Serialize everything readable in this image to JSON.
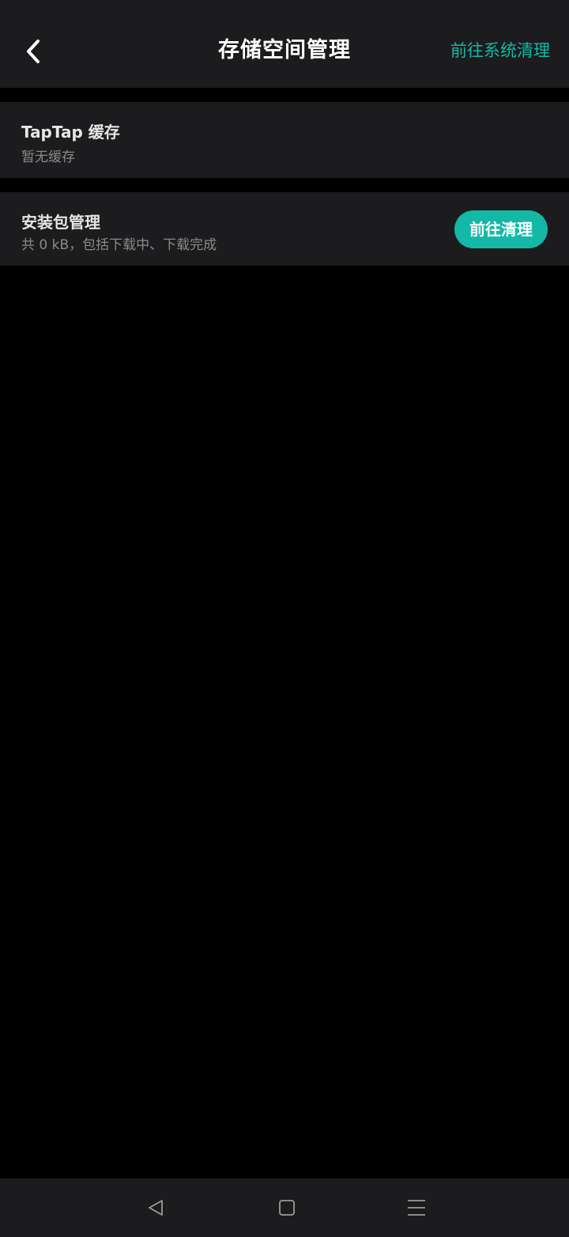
{
  "header": {
    "back_icon": "chevron-left-icon",
    "title": "存储空间管理",
    "system_clean_label": "前往系统清理"
  },
  "cache_card": {
    "title": "TapTap 缓存",
    "subtitle": "暂无缓存"
  },
  "apk_card": {
    "title": "安装包管理",
    "subtitle": "共 0 kB，包括下载中、下载完成",
    "button_label": "前往清理"
  },
  "navbar": {
    "back_icon": "triangle-back-icon",
    "home_icon": "square-home-icon",
    "menu_icon": "hamburger-menu-icon"
  },
  "colors": {
    "accent": "#14b8a6",
    "background": "#000000",
    "surface": "#1c1c1e"
  }
}
